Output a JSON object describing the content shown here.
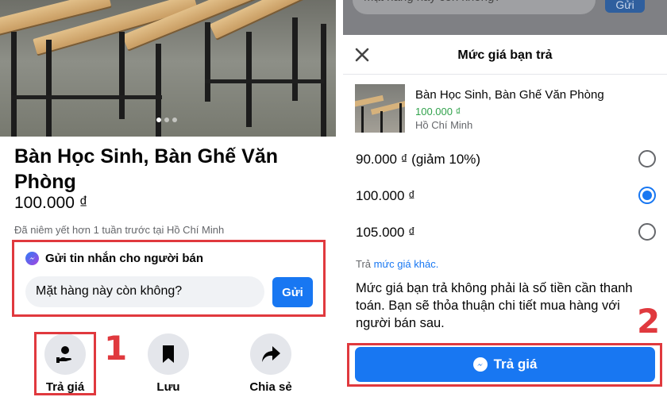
{
  "left": {
    "listing": {
      "title": "Bàn Học Sinh, Bàn Ghế Văn Phòng",
      "price": "100.000 ₫",
      "posted": "Đã niêm yết hơn 1 tuần trước tại Hồ Chí Minh"
    },
    "message_box": {
      "heading": "Gửi tin nhắn cho người bán",
      "input_value": "Mặt hàng này còn không?",
      "send_label": "Gửi"
    },
    "actions": [
      {
        "label": "Trả giá",
        "icon": "make-offer-icon"
      },
      {
        "label": "Lưu",
        "icon": "bookmark-icon"
      },
      {
        "label": "Chia sẻ",
        "icon": "share-icon"
      }
    ],
    "step_number": "1"
  },
  "right": {
    "background_bar": {
      "input_value": "Mặt hàng này còn không?",
      "send_label": "Gửi"
    },
    "sheet": {
      "title": "Mức giá bạn trả",
      "product": {
        "name": "Bàn Học Sinh, Bàn Ghế Văn Phòng",
        "price": "100.000 ₫",
        "location": "Hồ Chí Minh"
      },
      "options": [
        {
          "label": "90.000 ₫ (giảm 10%)",
          "selected": false
        },
        {
          "label": "100.000 ₫",
          "selected": true
        },
        {
          "label": "105.000 ₫",
          "selected": false
        }
      ],
      "other_prefix": "Trả ",
      "other_link": "mức giá khác.",
      "note": "Mức giá bạn trả không phải là số tiền cần thanh toán. Bạn sẽ thỏa thuận chi tiết mua hàng với người bán sau.",
      "submit_label": "Trả giá"
    },
    "step_number": "2"
  },
  "colors": {
    "accent": "#1877f2",
    "highlight_red": "#e0393e",
    "price_green": "#31a24c"
  }
}
